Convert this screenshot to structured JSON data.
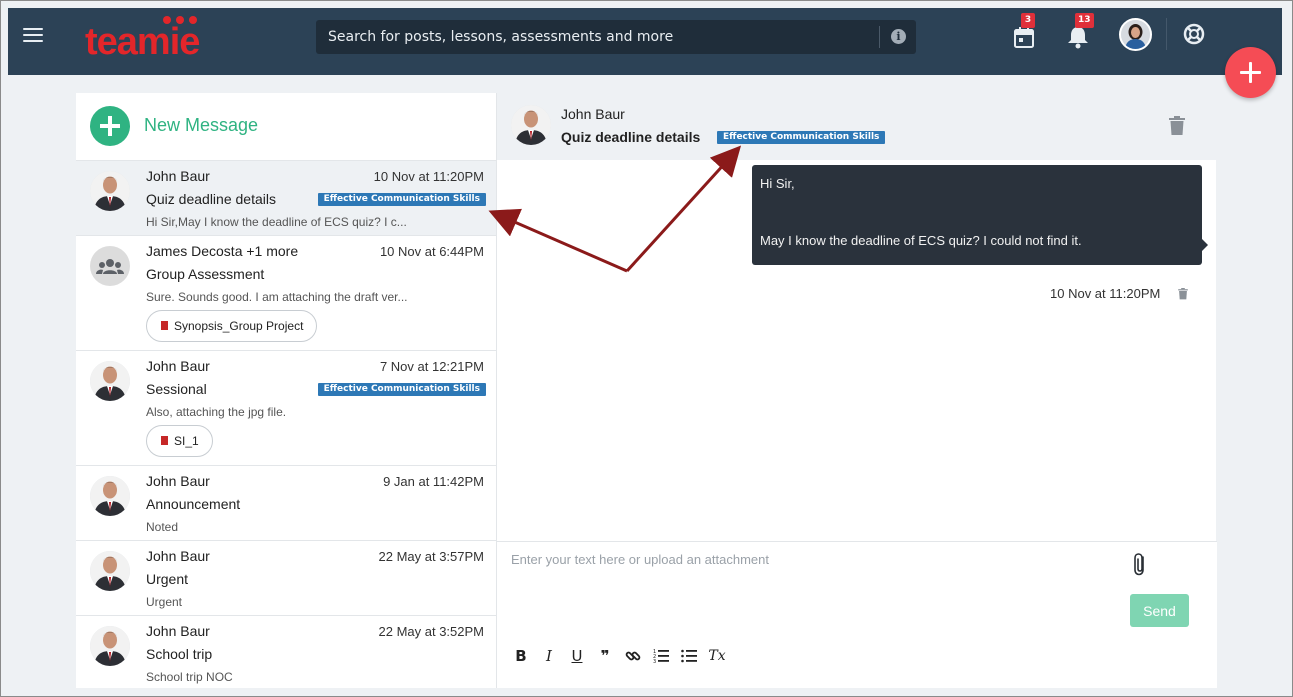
{
  "header": {
    "logo_text": "teamie",
    "search_placeholder": "Search for posts, lessons, assessments and more",
    "calendar_badge": "3",
    "notifications_badge": "13"
  },
  "sidebar": {
    "new_message_label": "New Message",
    "threads": [
      {
        "name": "John Baur",
        "time": "10 Nov at 11:20PM",
        "subject": "Quiz deadline details",
        "tag": "Effective Communication Skills",
        "preview": "Hi Sir,May I know the deadline of ECS quiz? I c...",
        "attachment": ""
      },
      {
        "name": "James Decosta +1 more",
        "time": "10 Nov at 6:44PM",
        "subject": "Group Assessment",
        "tag": "",
        "preview": "Sure. Sounds good. I am attaching the draft ver...",
        "attachment": "Synopsis_Group Project"
      },
      {
        "name": "John Baur",
        "time": "7 Nov at 12:21PM",
        "subject": "Sessional",
        "tag": "Effective Communication Skills",
        "preview": "Also, attaching the jpg file.",
        "attachment": "SI_1"
      },
      {
        "name": "John Baur",
        "time": "9 Jan at 11:42PM",
        "subject": "Announcement",
        "tag": "",
        "preview": "Noted",
        "attachment": ""
      },
      {
        "name": "John Baur",
        "time": "22 May at 3:57PM",
        "subject": "Urgent",
        "tag": "",
        "preview": "Urgent",
        "attachment": ""
      },
      {
        "name": "John Baur",
        "time": "22 May at 3:52PM",
        "subject": "School trip",
        "tag": "",
        "preview": "School trip NOC",
        "attachment": ""
      }
    ]
  },
  "conversation": {
    "name": "John Baur",
    "subject": "Quiz deadline details",
    "tag": "Effective Communication Skills",
    "message_line1": "Hi Sir,",
    "message_line2": "May I know the deadline of ECS quiz? I could not find it.",
    "message_time": "10 Nov at 11:20PM"
  },
  "composer": {
    "placeholder": "Enter your text here or upload an attachment",
    "send_label": "Send",
    "toolbar": {
      "bold": "B",
      "italic": "I",
      "underline": "U",
      "quote": "❞",
      "link": "🔗",
      "ordered_list": "≡",
      "bullet_list": "☰",
      "clear_format": "Tx"
    }
  },
  "colors": {
    "header_bg": "#2c4256",
    "logo_red": "#e3262a",
    "accent_green": "#2fb382",
    "tag_blue": "#2d78b6",
    "fab_red": "#f54c55",
    "bubble_dark": "#2a323c",
    "annotation_arrow": "#8b1a1a"
  },
  "icons": {
    "menu": "hamburger-icon",
    "calendar": "calendar-icon",
    "notifications": "bell-icon",
    "help": "lifebuoy-icon",
    "info": "info-icon",
    "trash": "trash-icon",
    "attach": "paperclip-icon",
    "group": "group-icon"
  }
}
